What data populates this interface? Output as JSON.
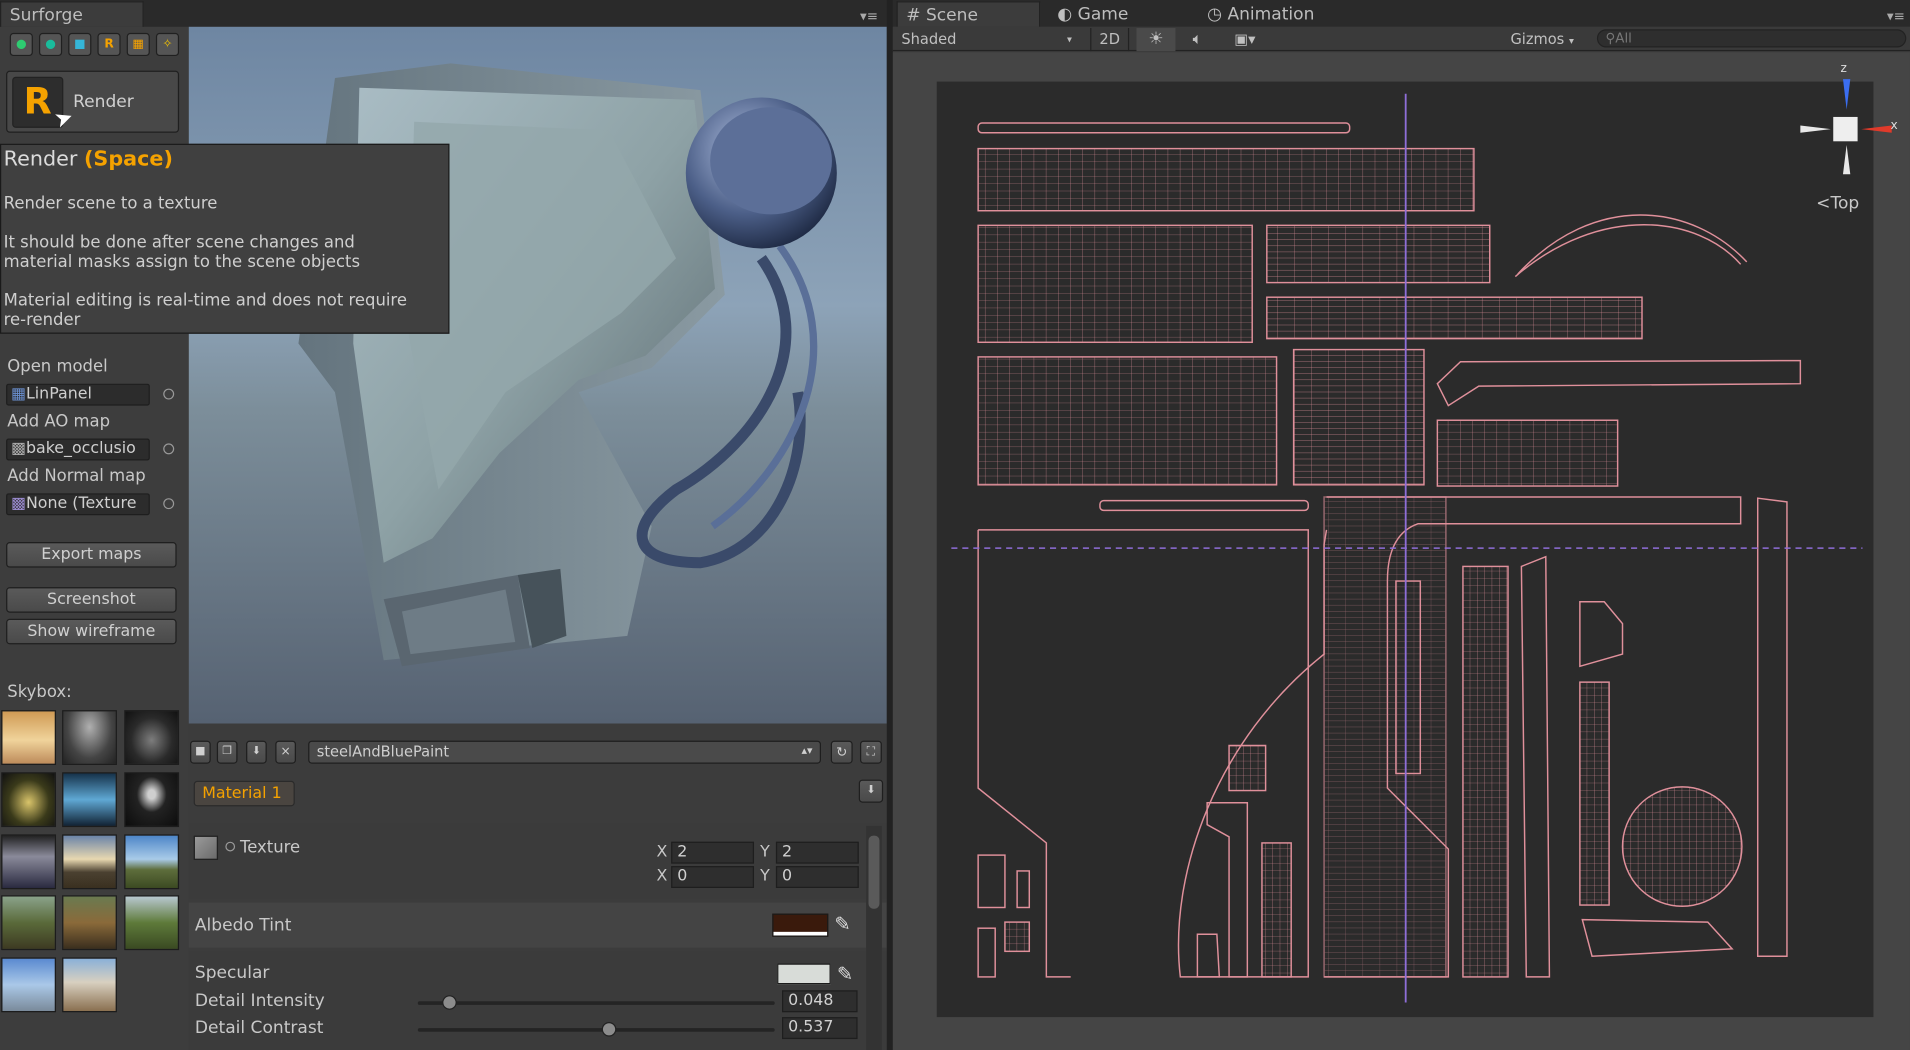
{
  "surforge": {
    "title": "Surforge",
    "tool_icons": [
      {
        "name": "green-sphere-icon",
        "glyph": "●",
        "color": "#2ecc71"
      },
      {
        "name": "teal-sphere-icon",
        "glyph": "●",
        "color": "#1abc9c"
      },
      {
        "name": "cube-icon",
        "glyph": "■",
        "color": "#35b6d8"
      },
      {
        "name": "render-r-icon",
        "glyph": "R",
        "color": "#f5a200"
      },
      {
        "name": "pattern-icon",
        "glyph": "▦",
        "color": "#f5a200"
      },
      {
        "name": "magic-icon",
        "glyph": "✧",
        "color": "#f5c400"
      }
    ],
    "render_label": "Render",
    "render_glyph": "R",
    "tooltip": {
      "title": "Render",
      "shortcut": "(Space)",
      "line1": "Render scene to a texture",
      "line2a": "It should be done after scene changes and",
      "line2b": "material masks assign to the scene objects",
      "line3a": "Material editing is real-time and does not require",
      "line3b": "re-render"
    },
    "open_model": "Open model",
    "model_value": "LinPanel",
    "add_ao": "Add AO map",
    "ao_value": "bake_occlusio",
    "add_normal": "Add Normal map",
    "normal_value": "None (Texture",
    "export_maps": "Export maps",
    "screenshot": "Screenshot",
    "show_wireframe": "Show wireframe",
    "skybox_label": "Skybox:"
  },
  "material": {
    "preset": "steelAndBluePaint",
    "tab_label": "Material 1",
    "texture_label": "Texture",
    "tiling_x_label": "X",
    "tiling_x": "2",
    "tiling_y_label": "Y",
    "tiling_y": "2",
    "offset_x_label": "X",
    "offset_x": "0",
    "offset_y_label": "Y",
    "offset_y": "0",
    "albedo_label": "Albedo Tint",
    "albedo_color": "#3a1a0c",
    "specular_label": "Specular",
    "specular_color": "#d8dcd8",
    "detail_intensity_label": "Detail Intensity",
    "detail_intensity": "0.048",
    "detail_intensity_level": 0.048,
    "detail_contrast_label": "Detail Contrast",
    "detail_contrast": "0.537",
    "detail_contrast_level": 0.537
  },
  "scene": {
    "tabs": [
      {
        "label": "Scene",
        "icon": "#"
      },
      {
        "label": "Game",
        "icon": "◐"
      },
      {
        "label": "Animation",
        "icon": "◷"
      }
    ],
    "shading": "Shaded",
    "mode_2d": "2D",
    "gizmos": "Gizmos",
    "search_placeholder": "All",
    "view_label": "Top",
    "axis_z": "z",
    "axis_x": "x"
  }
}
